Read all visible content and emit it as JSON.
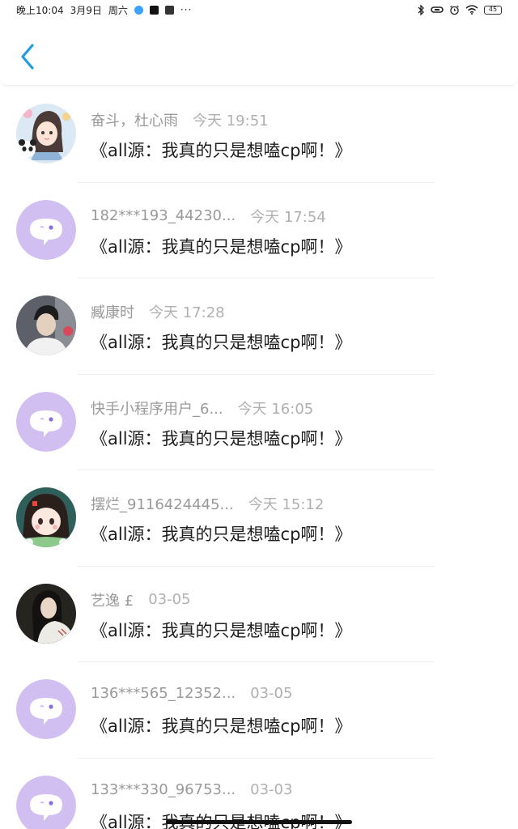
{
  "status_bar": {
    "time": "晚上10:04",
    "date": "3月9日",
    "weekday": "周六",
    "more": "···",
    "battery": "45"
  },
  "header": {
    "back_icon": "chevron-left-icon",
    "accent": "#1e9de6"
  },
  "messages": [
    {
      "name": "奋斗，杜心雨",
      "time": "今天 19:51",
      "title": "《all源：我真的只是想嗑cp啊！》",
      "avatar": "anime-girl-panda"
    },
    {
      "name": "182***193_44230...",
      "time": "今天 17:54",
      "title": "《all源：我真的只是想嗑cp啊！》",
      "avatar": "default-chat-bubble"
    },
    {
      "name": "臧康时",
      "time": "今天 17:28",
      "title": "《all源：我真的只是想嗑cp啊！》",
      "avatar": "photo-boy"
    },
    {
      "name": "快手小程序用户_6...",
      "time": "今天 16:05",
      "title": "《all源：我真的只是想嗑cp啊！》",
      "avatar": "default-chat-bubble"
    },
    {
      "name": "摆烂_9116424445...",
      "time": "今天 15:12",
      "title": "《all源：我真的只是想嗑cp啊！》",
      "avatar": "cartoon-girl"
    },
    {
      "name": "艺逸 £",
      "time": "03-05",
      "title": "《all源：我真的只是想嗑cp啊！》",
      "avatar": "photo-girl"
    },
    {
      "name": "136***565_12352...",
      "time": "03-05",
      "title": "《all源：我真的只是想嗑cp啊！》",
      "avatar": "default-chat-bubble"
    },
    {
      "name": "133***330_96753...",
      "time": "03-03",
      "title": "《all源：我真的只是想嗑cp啊！》",
      "avatar": "default-chat-bubble"
    }
  ]
}
